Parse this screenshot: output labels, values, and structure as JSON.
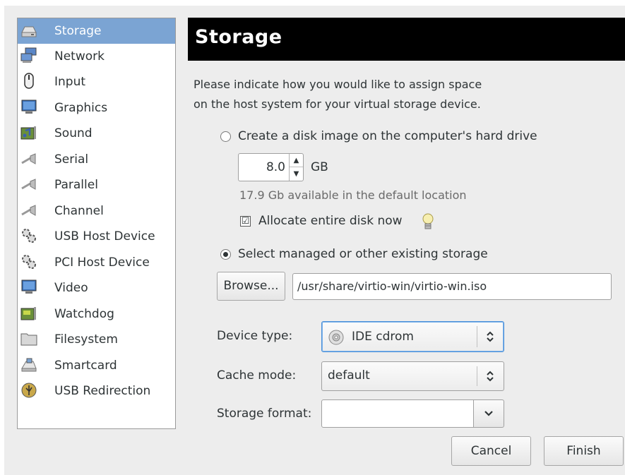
{
  "sidebar": {
    "items": [
      {
        "label": "Storage",
        "icon": "hard-disk-icon"
      },
      {
        "label": "Network",
        "icon": "network-icon"
      },
      {
        "label": "Input",
        "icon": "mouse-icon"
      },
      {
        "label": "Graphics",
        "icon": "monitor-icon"
      },
      {
        "label": "Sound",
        "icon": "sound-card-icon"
      },
      {
        "label": "Serial",
        "icon": "serial-plug-icon"
      },
      {
        "label": "Parallel",
        "icon": "parallel-plug-icon"
      },
      {
        "label": "Channel",
        "icon": "channel-plug-icon"
      },
      {
        "label": "USB Host Device",
        "icon": "usb-gears-icon"
      },
      {
        "label": "PCI Host Device",
        "icon": "pci-gears-icon"
      },
      {
        "label": "Video",
        "icon": "video-monitor-icon"
      },
      {
        "label": "Watchdog",
        "icon": "watchdog-card-icon"
      },
      {
        "label": "Filesystem",
        "icon": "folder-icon"
      },
      {
        "label": "Smartcard",
        "icon": "smartcard-icon"
      },
      {
        "label": "USB Redirection",
        "icon": "usb-icon"
      }
    ],
    "selected": "Storage"
  },
  "header": {
    "title": "Storage"
  },
  "description": {
    "line1": "Please indicate how you would like to assign space",
    "line2": "on the host system for your virtual storage device."
  },
  "create_disk": {
    "label": "Create a disk image on the computer's hard drive",
    "selected": false,
    "size_value": "8.0",
    "size_unit": "GB",
    "available": "17.9 Gb available in the default location",
    "allocate_label": "Allocate entire disk now",
    "allocate_checked": true,
    "allocate_check_glyph": "☑"
  },
  "existing_storage": {
    "label": "Select managed or other existing storage",
    "selected": true,
    "browse_label": "Browse...",
    "path": "/usr/share/virtio-win/virtio-win.iso"
  },
  "form": {
    "device_type_label": "Device type:",
    "device_type_value": "IDE cdrom",
    "cache_mode_label": "Cache mode:",
    "cache_mode_value": "default",
    "storage_format_label": "Storage format:",
    "storage_format_value": ""
  },
  "buttons": {
    "cancel": "Cancel",
    "finish": "Finish"
  },
  "colors": {
    "selection": "#7ba4d3",
    "header_bg": "#000000",
    "window_bg": "#ededed"
  }
}
